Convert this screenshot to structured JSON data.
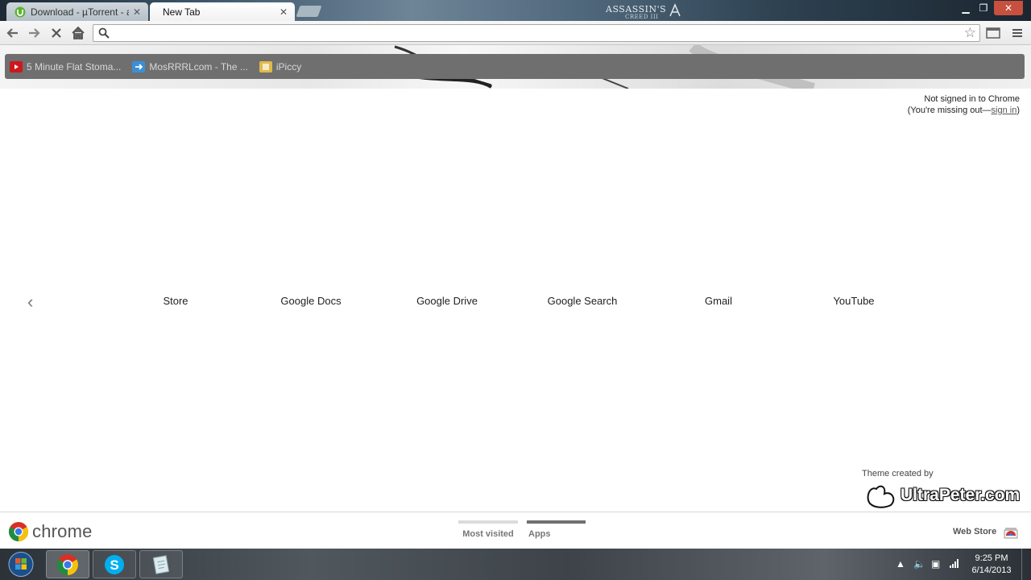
{
  "browser": {
    "tabs": [
      {
        "title": "Download - µTorrent - a (",
        "active": false,
        "favicon": "utorrent-icon"
      },
      {
        "title": "New Tab",
        "active": true,
        "favicon": ""
      }
    ],
    "theme_logo": "ASSASSIN'S CREED III",
    "window_controls": [
      "minimize-icon",
      "restore-icon",
      "close-icon"
    ]
  },
  "toolbar": {
    "omnibox": {
      "value": "",
      "placeholder": ""
    },
    "buttons": [
      "back-arrow-icon",
      "forward-arrow-icon",
      "stop-icon",
      "home-icon"
    ]
  },
  "bookmarks": [
    {
      "label": "5 Minute Flat Stoma...",
      "icon": "youtube-icon",
      "color": "#cc181e"
    },
    {
      "label": "MosRRRLcom - The ...",
      "icon": "arrow-square-icon",
      "color": "#3b8fd8"
    },
    {
      "label": "iPiccy",
      "icon": "ipiccy-icon",
      "color": "#e3b94a"
    }
  ],
  "signin": {
    "line1": "Not signed in to Chrome",
    "line2_prefix": "(You're missing out—",
    "link": "sign in",
    "line2_suffix": ")"
  },
  "apps": [
    "Store",
    "Google Docs",
    "Google Drive",
    "Google Search",
    "Gmail",
    "YouTube"
  ],
  "theme_credit": {
    "label": "Theme created by",
    "author": "UltraPeter.com"
  },
  "footer": {
    "logo_word": "chrome",
    "tabs": [
      {
        "label": "Most visited",
        "selected": false
      },
      {
        "label": "Apps",
        "selected": true
      }
    ],
    "web_store": "Web Store"
  },
  "taskbar": {
    "pinned": [
      "chrome-icon",
      "skype-icon",
      "notepad-icon"
    ],
    "clock_time": "9:25 PM",
    "clock_date": "6/14/2013"
  },
  "colors": {
    "bookmark_bar": "#6f6f6f",
    "tab_selected_bar": "#707070",
    "tab_unselected_bar": "#dcdcdc"
  }
}
